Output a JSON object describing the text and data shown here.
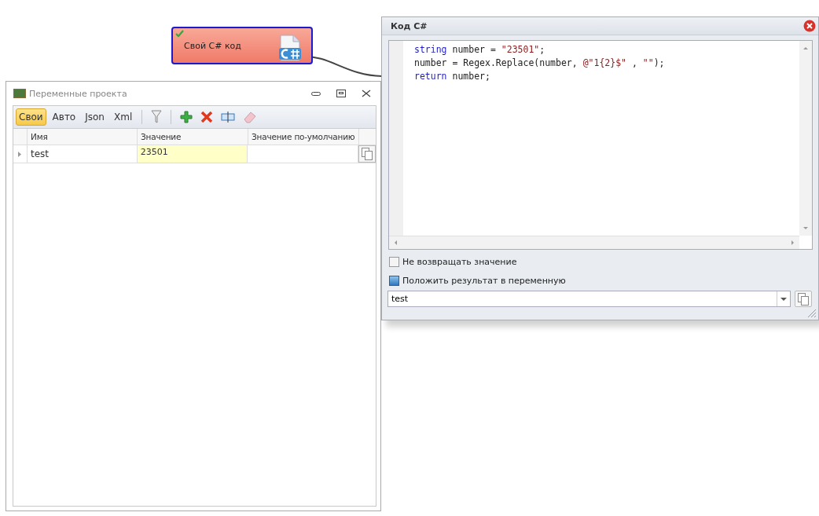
{
  "node": {
    "label": "Свой C# код",
    "ok": true
  },
  "variables_window": {
    "title": "Переменные проекта",
    "tabs": [
      {
        "label": "Свои",
        "selected": true
      },
      {
        "label": "Авто",
        "selected": false
      },
      {
        "label": "Json",
        "selected": false
      },
      {
        "label": "Xml",
        "selected": false
      }
    ],
    "columns": [
      "Имя",
      "Значение",
      "Значение по-умолчанию"
    ],
    "rows": [
      {
        "name": "test",
        "value": "23501"
      }
    ]
  },
  "code_window": {
    "title": "Код C#",
    "code_lines": [
      [
        {
          "kind": "keyword",
          "text": "string"
        },
        {
          "kind": "plain",
          "text": " number = "
        },
        {
          "kind": "string",
          "text": "\"23501\""
        },
        {
          "kind": "plain",
          "text": ";"
        }
      ],
      [
        {
          "kind": "plain",
          "text": "number = Regex.Replace(number, "
        },
        {
          "kind": "string",
          "text": "@\"1{2}$\""
        },
        {
          "kind": "plain",
          "text": " , "
        },
        {
          "kind": "string",
          "text": "\"\""
        },
        {
          "kind": "plain",
          "text": ");"
        }
      ],
      [
        {
          "kind": "keyword",
          "text": "return"
        },
        {
          "kind": "plain",
          "text": " number;"
        }
      ]
    ],
    "options": [
      {
        "label": "Не возвращать значение",
        "checked": false
      },
      {
        "label": "Положить результат в переменную",
        "checked": true
      }
    ],
    "result_variable": "test"
  }
}
